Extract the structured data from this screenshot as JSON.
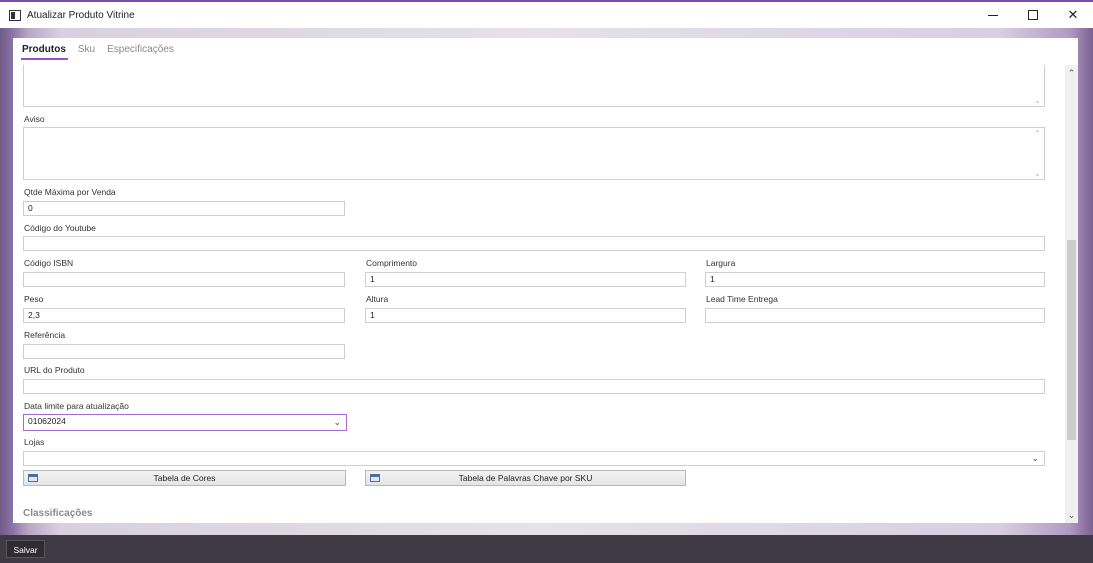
{
  "window": {
    "title": "Atualizar Produto Vitrine",
    "minimize_icon": "minimize-icon",
    "maximize_icon": "maximize-icon",
    "close_icon": "close-icon",
    "close_glyph": "✕",
    "accent_color": "#9b4fd0"
  },
  "tabs": [
    {
      "label": "Produtos",
      "active": true
    },
    {
      "label": "Sku",
      "active": false
    },
    {
      "label": "Especificações",
      "active": false
    }
  ],
  "form": {
    "aviso_label": "Aviso",
    "qtde_label": "Qtde Máxima por Venda",
    "qtde_value": "0",
    "youtube_label": "Código do Youtube",
    "youtube_value": "",
    "isbn_label": "Código ISBN",
    "isbn_value": "",
    "comprimento_label": "Comprimento",
    "comprimento_value": "1",
    "largura_label": "Largura",
    "largura_value": "1",
    "peso_label": "Peso",
    "peso_value": "2,3",
    "altura_label": "Altura",
    "altura_value": "1",
    "leadtime_label": "Lead Time Entrega",
    "leadtime_value": "",
    "referencia_label": "Referência",
    "referencia_value": "",
    "url_label": "URL do Produto",
    "url_value": "",
    "data_limite_label": "Data limite para atualização",
    "data_limite_value": "01062024",
    "lojas_label": "Lojas",
    "lojas_value": ""
  },
  "buttons": {
    "tabela_cores": "Tabela de Cores",
    "tabela_palavras": "Tabela de Palavras Chave por SKU",
    "salvar": "Salvar"
  },
  "sections": {
    "classificacoes": "Classificações"
  }
}
